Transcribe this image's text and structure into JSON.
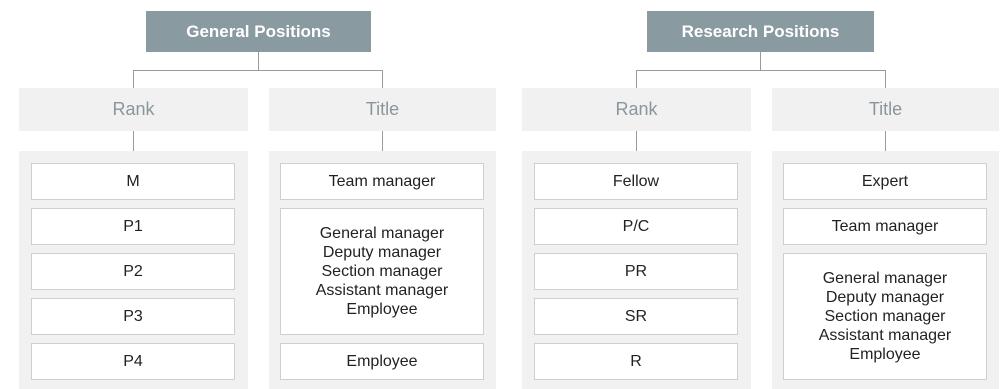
{
  "general": {
    "title": "General Positions",
    "rank_header": "Rank",
    "title_header": "Title",
    "ranks": [
      "M",
      "P1",
      "P2",
      "P3",
      "P4"
    ],
    "titles": {
      "t1": "Team manager",
      "t2": [
        "General manager",
        "Deputy manager",
        "Section manager",
        "Assistant manager",
        "Employee"
      ],
      "t3": "Employee"
    }
  },
  "research": {
    "title": "Research Positions",
    "rank_header": "Rank",
    "title_header": "Title",
    "ranks": [
      "Fellow",
      "P/C",
      "PR",
      "SR",
      "R"
    ],
    "titles": {
      "t1": "Expert",
      "t2": "Team manager",
      "t3": [
        "General manager",
        "Deputy manager",
        "Section manager",
        "Assistant manager",
        "Employee"
      ]
    }
  },
  "colors": {
    "header_bg": "#8a9aa1",
    "column_header_bg": "#f1f1f1",
    "column_header_text": "#8a969c",
    "box_border": "#cfcfcf",
    "connector": "#9a9a9a"
  }
}
